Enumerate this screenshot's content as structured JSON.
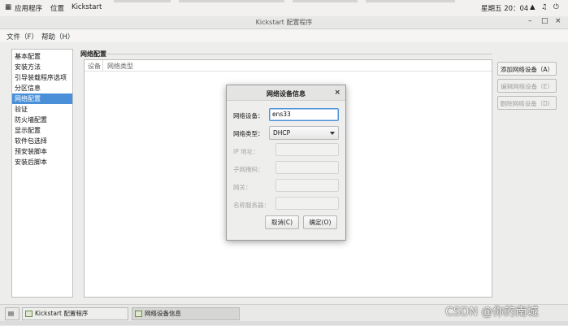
{
  "topbar": {
    "apps": "应用程序",
    "places": "位置",
    "app_name": "Kickstart",
    "clock": "星期五 20：04"
  },
  "window": {
    "title": "Kickstart 配置程序",
    "min": "–",
    "max": "□",
    "close": "×"
  },
  "menubar": {
    "file": "文件（F）",
    "help": "帮助（H）"
  },
  "sidebar": {
    "items": [
      {
        "label": "基本配置"
      },
      {
        "label": "安装方法"
      },
      {
        "label": "引导装载程序选项"
      },
      {
        "label": "分区信息"
      },
      {
        "label": "网络配置",
        "selected": true
      },
      {
        "label": "验证"
      },
      {
        "label": "防火墙配置"
      },
      {
        "label": "显示配置"
      },
      {
        "label": "软件包选择"
      },
      {
        "label": "预安装脚本"
      },
      {
        "label": "安装后脚本"
      }
    ]
  },
  "network": {
    "group_title": "网络配置",
    "columns": [
      "设备",
      "网络类型"
    ],
    "add_button": "添加网络设备（A）",
    "edit_button": "编辑网络设备（E）",
    "delete_button": "删除网络设备（D）"
  },
  "dialog": {
    "title": "网络设备信息",
    "close": "×",
    "device_label": "网络设备：",
    "device_value": "ens33",
    "type_label": "网络类型：",
    "type_value": "DHCP",
    "ip_label": "IP 地址：",
    "netmask_label": "子网掩码：",
    "gateway_label": "网关：",
    "dns_label": "名称服务器：",
    "cancel": "取消(C)",
    "ok": "确定(O)"
  },
  "taskbar": {
    "task1": "Kickstart 配置程序",
    "task2": "网络设备信息"
  },
  "watermark": "CSDN @你的南城",
  "colors": {
    "selection": "#4a90d9",
    "focus_border": "#4a90d9"
  }
}
